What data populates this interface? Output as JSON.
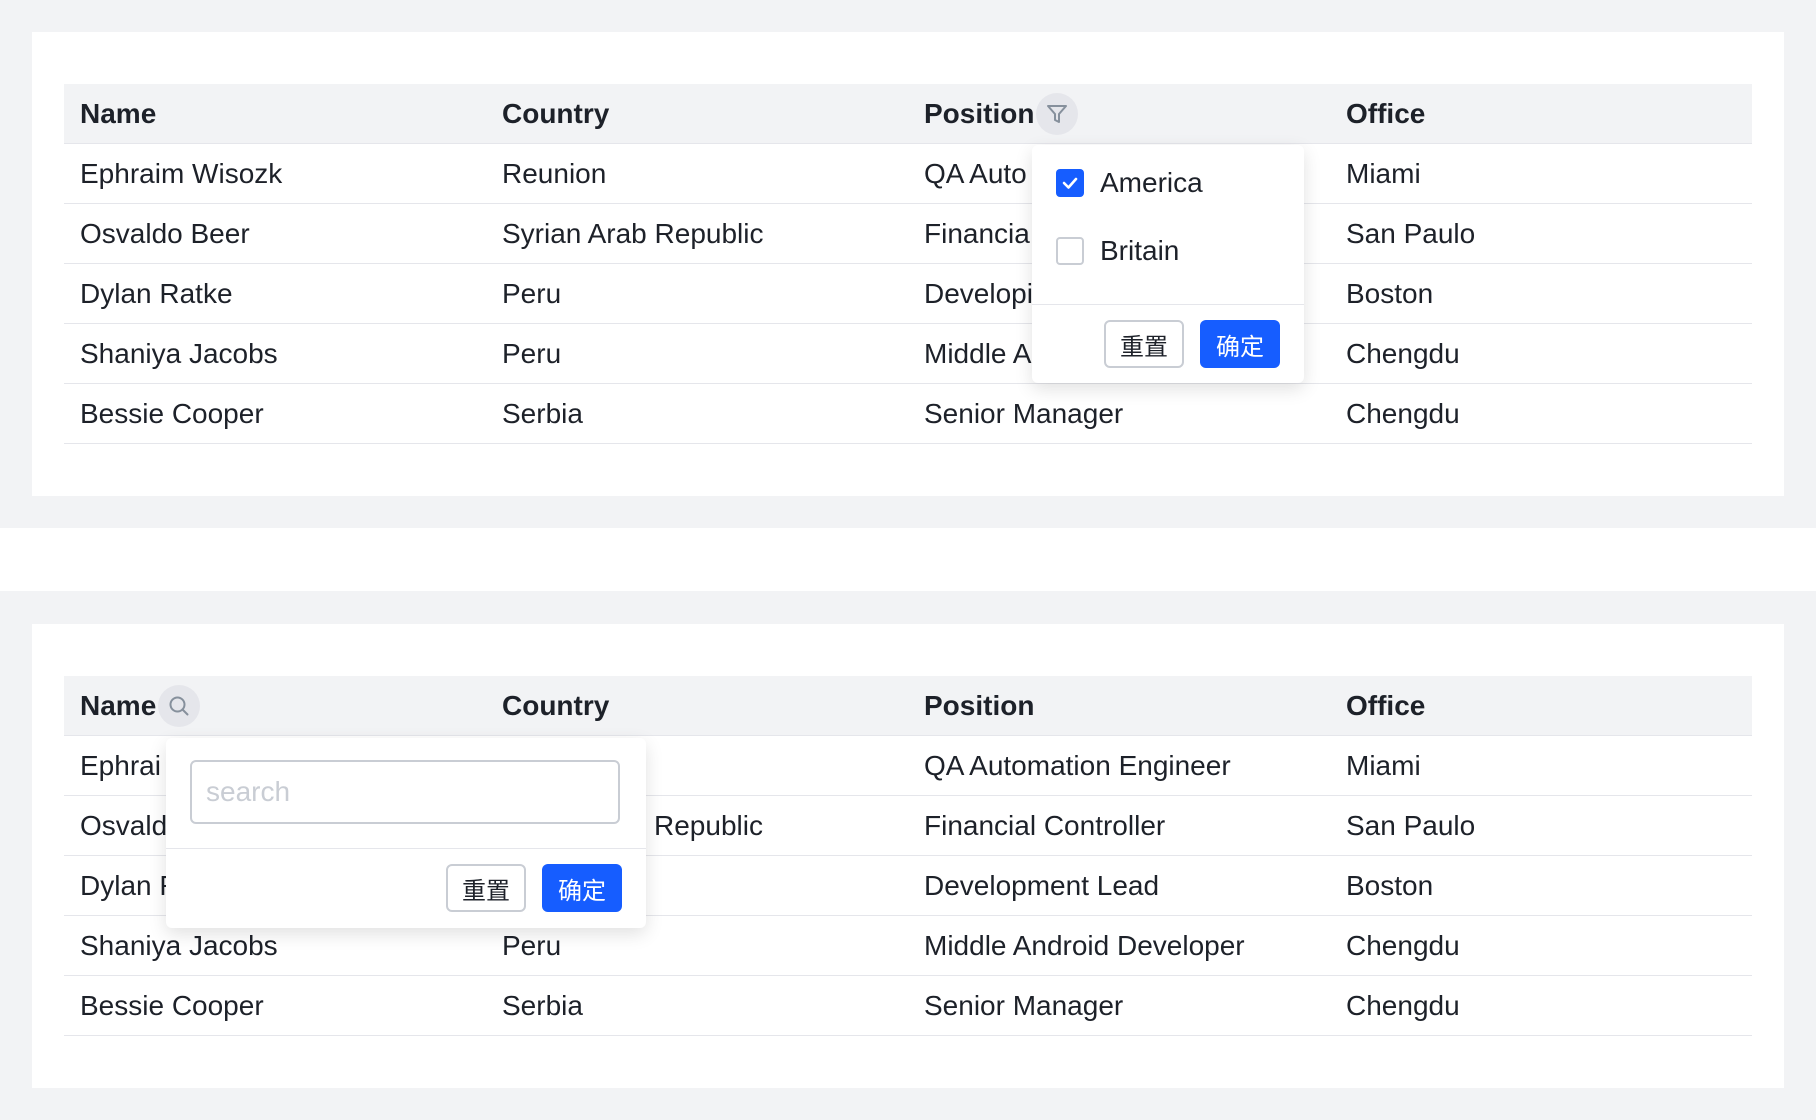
{
  "columns": [
    "Name",
    "Country",
    "Position",
    "Office"
  ],
  "table1": {
    "rows": [
      [
        "Ephraim Wisozk",
        "Reunion",
        "QA Auto",
        "Miami"
      ],
      [
        "Osvaldo Beer",
        "Syrian Arab Republic",
        "Financia",
        "San Paulo"
      ],
      [
        "Dylan Ratke",
        "Peru",
        "Developi",
        "Boston"
      ],
      [
        "Shaniya Jacobs",
        "Peru",
        "Middle A",
        "Chengdu"
      ],
      [
        "Bessie Cooper",
        "Serbia",
        "Senior Manager",
        "Chengdu"
      ]
    ],
    "filter_icon": "filter-icon",
    "filter_popup": {
      "options": [
        {
          "label": "America",
          "checked": true
        },
        {
          "label": "Britain",
          "checked": false
        }
      ],
      "reset_label": "重置",
      "confirm_label": "确定"
    }
  },
  "table2": {
    "rows": [
      [
        "Ephrai",
        "",
        "QA Automation Engineer",
        "Miami"
      ],
      [
        "Osvald",
        "Republic",
        "Financial Controller",
        "San Paulo"
      ],
      [
        "Dylan R",
        "",
        "Development Lead",
        "Boston"
      ],
      [
        "Shaniya Jacobs",
        "Peru",
        "Middle Android Developer",
        "Chengdu"
      ],
      [
        "Bessie Cooper",
        "Serbia",
        "Senior Manager",
        "Chengdu"
      ]
    ],
    "search_icon": "search-icon",
    "search_popup": {
      "placeholder": "search",
      "value": "",
      "reset_label": "重置",
      "confirm_label": "确定"
    }
  },
  "colors": {
    "accent": "#165dff",
    "header_bg": "#f2f3f5",
    "border": "#e5e6eb"
  }
}
